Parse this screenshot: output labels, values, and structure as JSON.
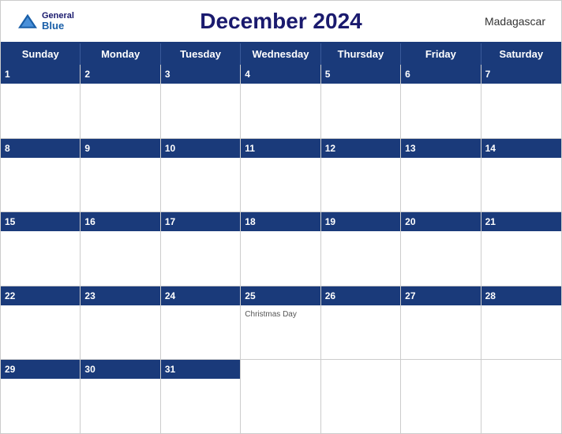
{
  "header": {
    "title": "December 2024",
    "country": "Madagascar",
    "logo_general": "General",
    "logo_blue": "Blue"
  },
  "days_of_week": [
    "Sunday",
    "Monday",
    "Tuesday",
    "Wednesday",
    "Thursday",
    "Friday",
    "Saturday"
  ],
  "weeks": [
    [
      {
        "day": 1,
        "events": []
      },
      {
        "day": 2,
        "events": []
      },
      {
        "day": 3,
        "events": []
      },
      {
        "day": 4,
        "events": []
      },
      {
        "day": 5,
        "events": []
      },
      {
        "day": 6,
        "events": []
      },
      {
        "day": 7,
        "events": []
      }
    ],
    [
      {
        "day": 8,
        "events": []
      },
      {
        "day": 9,
        "events": []
      },
      {
        "day": 10,
        "events": []
      },
      {
        "day": 11,
        "events": []
      },
      {
        "day": 12,
        "events": []
      },
      {
        "day": 13,
        "events": []
      },
      {
        "day": 14,
        "events": []
      }
    ],
    [
      {
        "day": 15,
        "events": []
      },
      {
        "day": 16,
        "events": []
      },
      {
        "day": 17,
        "events": []
      },
      {
        "day": 18,
        "events": []
      },
      {
        "day": 19,
        "events": []
      },
      {
        "day": 20,
        "events": []
      },
      {
        "day": 21,
        "events": []
      }
    ],
    [
      {
        "day": 22,
        "events": []
      },
      {
        "day": 23,
        "events": []
      },
      {
        "day": 24,
        "events": []
      },
      {
        "day": 25,
        "events": [
          "Christmas Day"
        ]
      },
      {
        "day": 26,
        "events": []
      },
      {
        "day": 27,
        "events": []
      },
      {
        "day": 28,
        "events": []
      }
    ],
    [
      {
        "day": 29,
        "events": []
      },
      {
        "day": 30,
        "events": []
      },
      {
        "day": 31,
        "events": []
      },
      {
        "day": null,
        "events": []
      },
      {
        "day": null,
        "events": []
      },
      {
        "day": null,
        "events": []
      },
      {
        "day": null,
        "events": []
      }
    ]
  ]
}
